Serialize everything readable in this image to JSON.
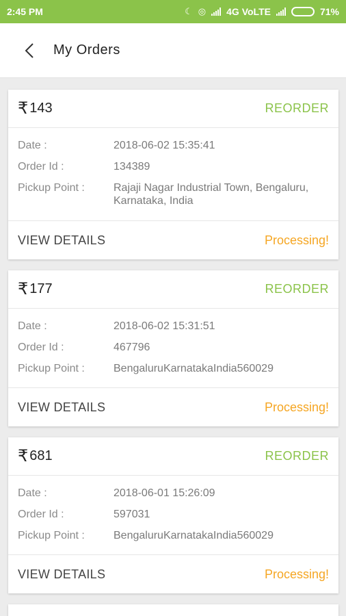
{
  "status_bar": {
    "time": "2:45 PM",
    "network": "4G VoLTE",
    "battery": "71%",
    "battery_level": 0.71
  },
  "header": {
    "title": "My Orders",
    "back_icon": "chevron-left-icon"
  },
  "currency_symbol": "₹",
  "labels": {
    "date": "Date :",
    "order_id": "Order Id :",
    "pickup": "Pickup Point :",
    "reorder": "REORDER",
    "view_details": "VIEW DETAILS"
  },
  "orders": [
    {
      "amount": "143",
      "date": "2018-06-02 15:35:41",
      "order_id": "134389",
      "pickup_point": "Rajaji Nagar Industrial Town, Bengaluru, Karnataka, India",
      "status": "Processing!"
    },
    {
      "amount": "177",
      "date": "2018-06-02 15:31:51",
      "order_id": "467796",
      "pickup_point": "BengaluruKarnatakaIndia560029",
      "status": "Processing!"
    },
    {
      "amount": "681",
      "date": "2018-06-01 15:26:09",
      "order_id": "597031",
      "pickup_point": "BengaluruKarnatakaIndia560029",
      "status": "Processing!"
    }
  ],
  "colors": {
    "accent": "#8bc34a",
    "status": "#f5a623"
  }
}
